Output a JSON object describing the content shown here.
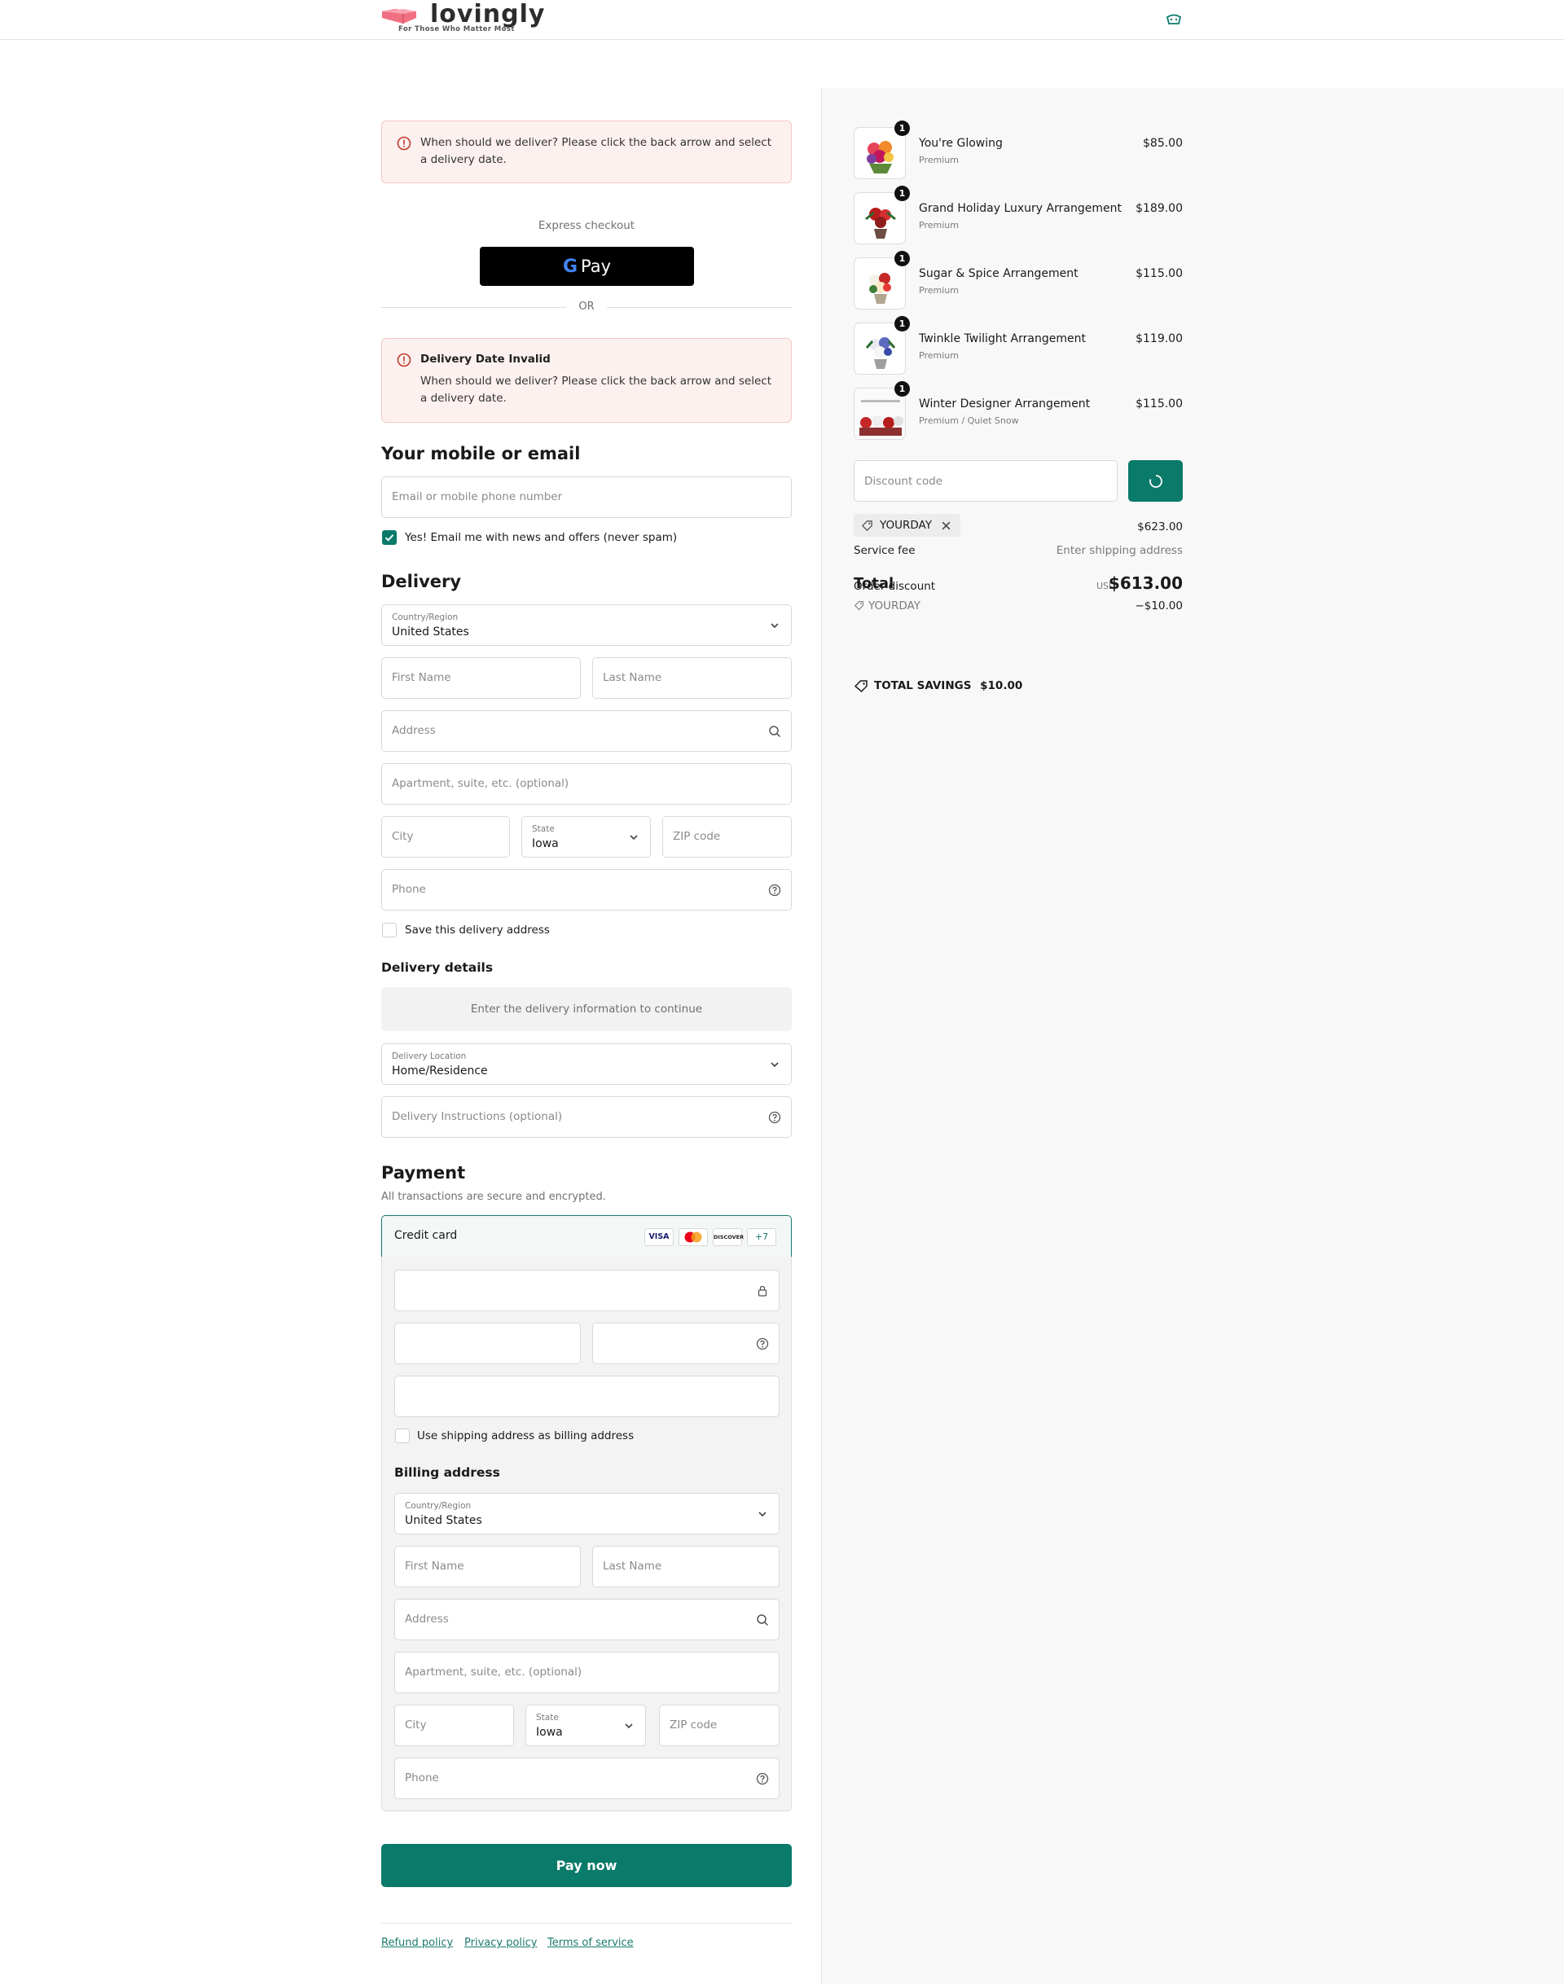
{
  "header": {
    "logo_text": "lovingly",
    "logo_tagline": "For Those Who Matter Most",
    "cart_icon": "cart-icon"
  },
  "alerts": {
    "top_message": "When should we deliver? Please click the back arrow and select a delivery date.",
    "second_title": "Delivery Date Invalid",
    "second_message": "When should we deliver? Please click the back arrow and select a delivery date."
  },
  "express": {
    "label": "Express checkout",
    "gpay_label": "Pay",
    "gpay_g": "G",
    "or": "OR"
  },
  "contact": {
    "title": "Your mobile or email",
    "email_placeholder": "Email or mobile phone number",
    "newsletter_label": "Yes! Email me with news and offers (never spam)",
    "newsletter_checked": true
  },
  "delivery": {
    "title": "Delivery",
    "country_label": "Country/Region",
    "country_value": "United States",
    "first_name": "First Name",
    "last_name": "Last Name",
    "address": "Address",
    "apartment": "Apartment, suite, etc. (optional)",
    "city": "City",
    "state_label": "State",
    "state_value": "Iowa",
    "zip": "ZIP code",
    "phone": "Phone",
    "save_label": "Save this delivery address"
  },
  "delivery_details": {
    "title": "Delivery details",
    "info": "Enter the delivery information to continue",
    "location_label": "Delivery Location",
    "location_value": "Home/Residence",
    "instructions": "Delivery Instructions (optional)"
  },
  "payment": {
    "title": "Payment",
    "subtitle": "All transactions are secure and encrypted.",
    "method_label": "Credit card",
    "brands": [
      "VISA",
      "",
      "DISCOVER",
      "+7"
    ],
    "same_address_label": "Use shipping address as billing address"
  },
  "billing": {
    "title": "Billing address",
    "country_label": "Country/Region",
    "country_value": "United States",
    "first_name": "First Name",
    "last_name": "Last Name",
    "address": "Address",
    "apartment": "Apartment, suite, etc. (optional)",
    "city": "City",
    "state_label": "State",
    "state_value": "Iowa",
    "zip": "ZIP code",
    "phone": "Phone"
  },
  "pay_button": "Pay now",
  "footer": {
    "links": [
      "Refund policy",
      "Privacy policy",
      "Terms of service"
    ]
  },
  "summary": {
    "items": [
      {
        "qty": "1",
        "name": "You're Glowing",
        "variant": "Premium",
        "price": "$85.00"
      },
      {
        "qty": "1",
        "name": "Grand Holiday Luxury Arrangement",
        "variant": "Premium",
        "price": "$189.00"
      },
      {
        "qty": "1",
        "name": "Sugar & Spice Arrangement",
        "variant": "Premium",
        "price": "$115.00"
      },
      {
        "qty": "1",
        "name": "Twinkle Twilight Arrangement",
        "variant": "Premium",
        "price": "$119.00"
      },
      {
        "qty": "1",
        "name": "Winter Designer Arrangement",
        "variant": "Premium / Quiet Snow",
        "price": "$115.00"
      }
    ],
    "discount_placeholder": "Discount code",
    "applied_code": "YOURDAY",
    "subtotal": "$623.00",
    "service_fee_label": "Service fee",
    "service_fee_value": "Enter shipping address",
    "order_discount_label": "Order discount",
    "order_discount_code": "YOURDAY",
    "order_discount_value": "−$10.00",
    "total_label": "Total",
    "currency": "USD",
    "total": "$613.00",
    "savings_label": "TOTAL SAVINGS",
    "savings_value": "$10.00"
  },
  "colors": {
    "accent": "#0a7a6a",
    "error_bg": "#fdf1f0",
    "error_border": "#f3c9c4",
    "error_icon": "#c0392b"
  }
}
